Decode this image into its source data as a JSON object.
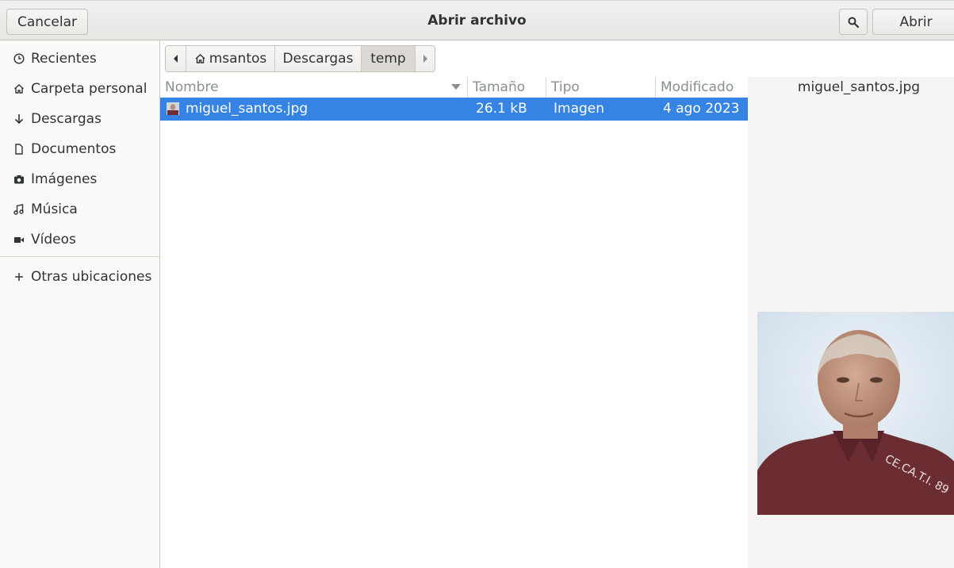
{
  "header": {
    "title": "Abrir archivo",
    "cancel_label": "Cancelar",
    "open_label": "Abrir",
    "search_icon": "search-icon"
  },
  "sidebar": {
    "items": [
      {
        "label": "Recientes",
        "icon": "clock-icon"
      },
      {
        "label": "Carpeta personal",
        "icon": "home-icon"
      },
      {
        "label": "Descargas",
        "icon": "download-arrow-icon"
      },
      {
        "label": "Documentos",
        "icon": "document-icon"
      },
      {
        "label": "Imágenes",
        "icon": "camera-icon"
      },
      {
        "label": "Música",
        "icon": "music-note-icon"
      },
      {
        "label": "Vídeos",
        "icon": "video-camera-icon"
      },
      {
        "label": "Otras ubicaciones",
        "icon": "plus-icon"
      }
    ]
  },
  "pathbar": {
    "segments": [
      "msantos",
      "Descargas",
      "temp"
    ],
    "active": "temp"
  },
  "columns": {
    "name": "Nombre",
    "size": "Tamaño",
    "type": "Tipo",
    "modified": "Modificado"
  },
  "files": [
    {
      "name": "miguel_santos.jpg",
      "size": "26.1 kB",
      "type": "Imagen",
      "modified": "4 ago 2023",
      "selected": true
    }
  ],
  "preview": {
    "filename": "miguel_santos.jpg",
    "watermark": "CE.CA.T.I. 89"
  },
  "colors": {
    "selection": "#3584e4",
    "header_bg": "#ebe9e6",
    "sidebar_bg": "#fbfaf9"
  }
}
